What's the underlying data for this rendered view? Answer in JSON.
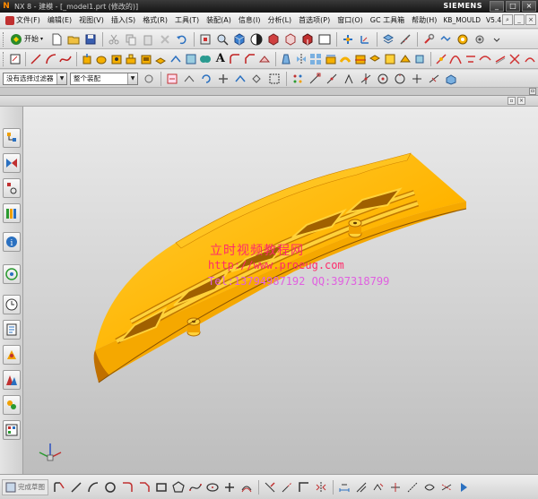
{
  "window": {
    "title": "NX 8 - 建模 - [_model1.prt (修改的)]",
    "brand": "SIEMENS",
    "controls": [
      "_",
      "□",
      "×"
    ]
  },
  "menu": {
    "items": [
      "文件(F)",
      "编辑(E)",
      "视图(V)",
      "插入(S)",
      "格式(R)",
      "工具(T)",
      "装配(A)",
      "信息(I)",
      "分析(L)",
      "首选项(P)",
      "窗口(O)",
      "GC 工具箱",
      "帮助(H)"
    ],
    "module": "KB_MOULD",
    "version": "V5.4"
  },
  "toolbar": {
    "start_label": "开始"
  },
  "selection": {
    "filter_value": "没有选择过滤器",
    "scope_value": "整个装配"
  },
  "bottom": {
    "sketch_label": "完成草图"
  },
  "watermark": {
    "title": "立时视频教程网",
    "url": "http://www.proeug.com",
    "contact": "Tel:13794987192  QQ:397318799"
  },
  "colors": {
    "part_main": "#ffb000",
    "part_shade": "#e08a00",
    "part_light": "#ffd23a",
    "watermark_red": "#ff2a6a",
    "watermark_magenta": "#e060e0"
  }
}
